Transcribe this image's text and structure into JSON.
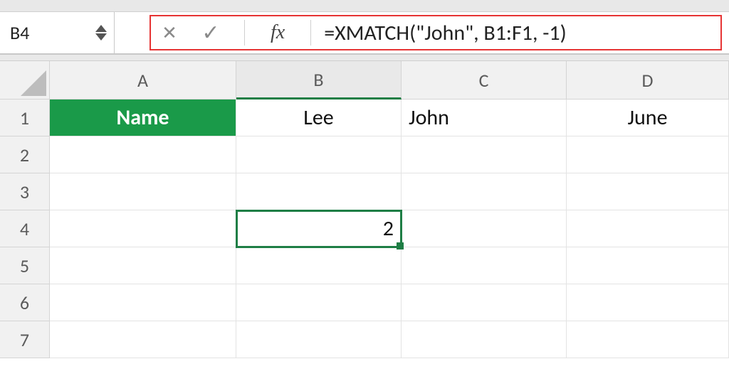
{
  "name_box": {
    "value": "B4"
  },
  "formula_bar": {
    "fx_label": "fx",
    "formula": "=XMATCH(\"John\", B1:F1, -1)"
  },
  "columns": [
    "A",
    "B",
    "C",
    "D"
  ],
  "rows": [
    "1",
    "2",
    "3",
    "4",
    "5",
    "6",
    "7"
  ],
  "active_column": "B",
  "active_cell_ref": "B4",
  "cells": {
    "A1": {
      "value": "Name",
      "style": "header-green",
      "align": "center"
    },
    "B1": {
      "value": "Lee",
      "align": "center"
    },
    "C1": {
      "value": "John",
      "align": "left"
    },
    "D1": {
      "value": "June",
      "align": "center"
    },
    "B4": {
      "value": "2",
      "align": "right"
    }
  },
  "colors": {
    "header_green": "#1a9a49",
    "selection_border": "#1e7e45",
    "formula_highlight": "#e63434"
  },
  "chart_data": {
    "type": "table",
    "headers_row": [
      "Name"
    ],
    "data_row": [
      "Lee",
      "John",
      "June"
    ],
    "computed": {
      "cell": "B4",
      "formula": "=XMATCH(\"John\", B1:F1, -1)",
      "result": 2
    }
  }
}
